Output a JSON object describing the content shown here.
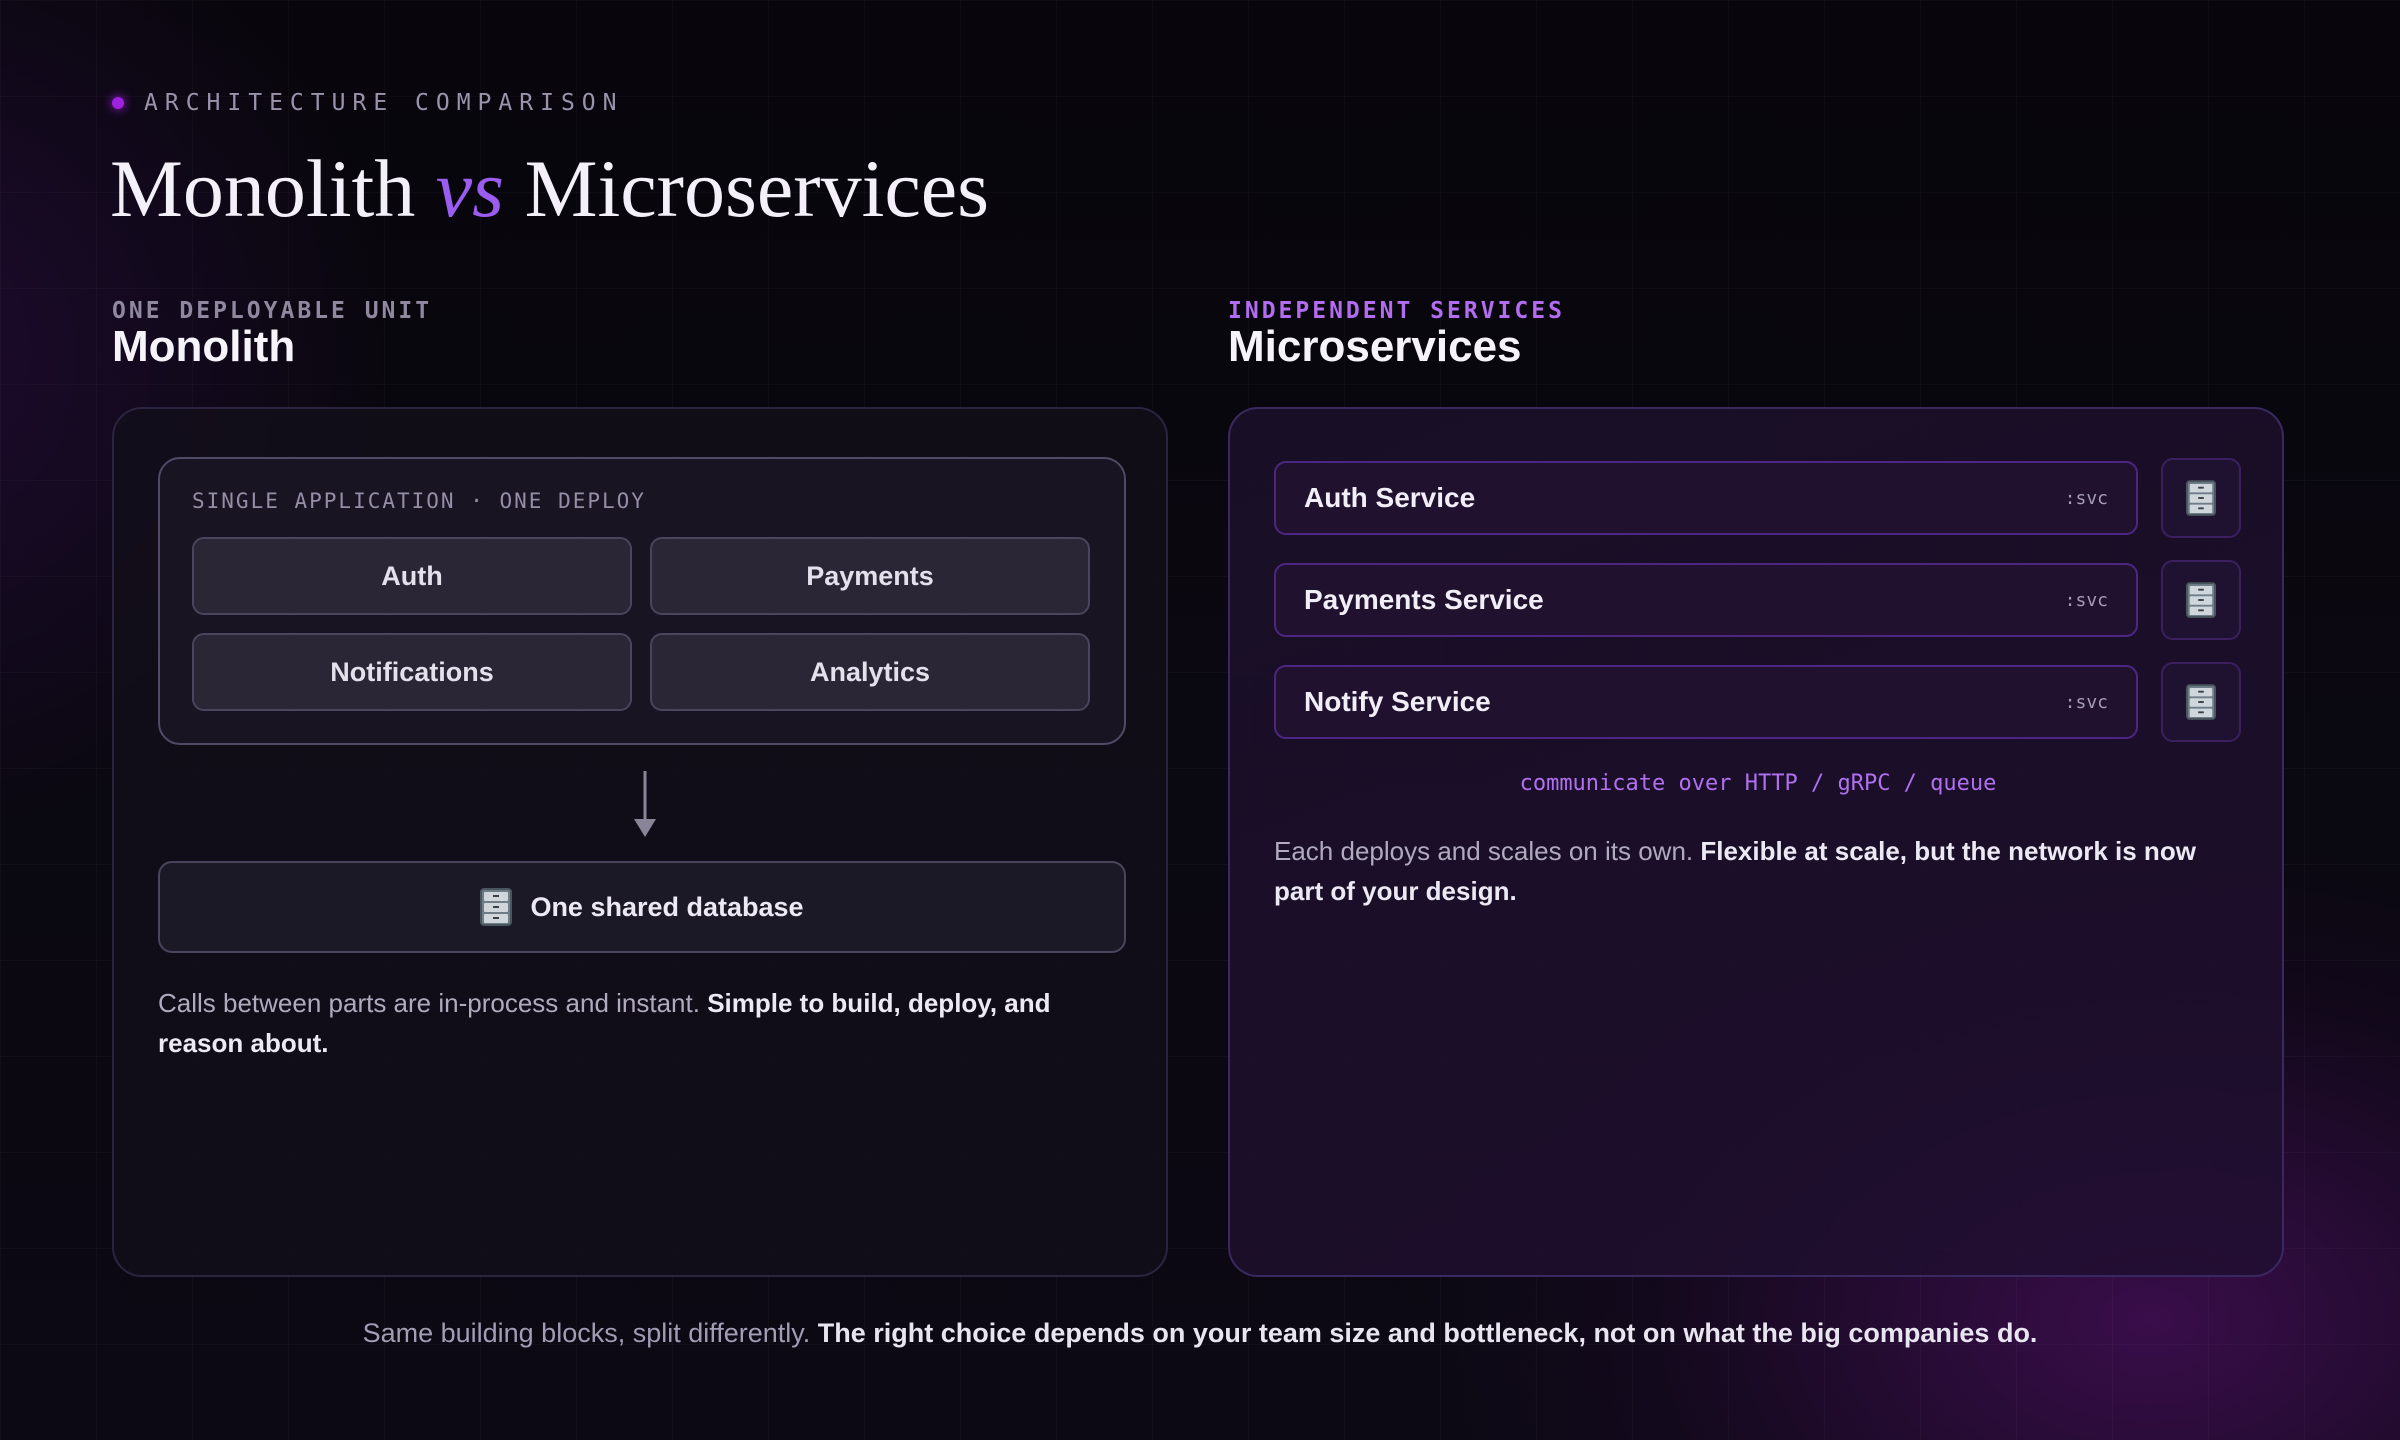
{
  "header": {
    "kicker": "ARCHITECTURE COMPARISON",
    "title_left": "Monolith",
    "title_vs": "vs",
    "title_right": "Microservices"
  },
  "monolith": {
    "eyebrow": "ONE DEPLOYABLE UNIT",
    "heading": "Monolith",
    "app_label": "SINGLE APPLICATION · ONE DEPLOY",
    "modules": [
      "Auth",
      "Payments",
      "Notifications",
      "Analytics"
    ],
    "database": "One shared database",
    "desc_plain": "Calls between parts are in-process and instant. ",
    "desc_bold": "Simple to build, deploy, and reason about."
  },
  "microservices": {
    "eyebrow": "INDEPENDENT SERVICES",
    "heading": "Microservices",
    "services": [
      {
        "name": "Auth Service",
        "tag": ":svc"
      },
      {
        "name": "Payments Service",
        "tag": ":svc"
      },
      {
        "name": "Notify Service",
        "tag": ":svc"
      }
    ],
    "communication": "communicate over HTTP / gRPC / queue",
    "desc_plain": "Each deploys and scales on its own. ",
    "desc_bold": "Flexible at scale, but the network is now part of your design."
  },
  "footer": {
    "plain": "Same building blocks, split differently. ",
    "bold": "The right choice depends on your team size and bottleneck, not on what the big companies do."
  },
  "colors": {
    "accent_purple": "#9b5cf0",
    "eyebrow_purple": "#b26cf0",
    "eyebrow_gray": "#8f889f",
    "kicker_dot": "#a020e0"
  },
  "icons": {
    "kicker": "dot-icon",
    "database": "file-cabinet-icon",
    "flow": "arrow-down-icon"
  }
}
